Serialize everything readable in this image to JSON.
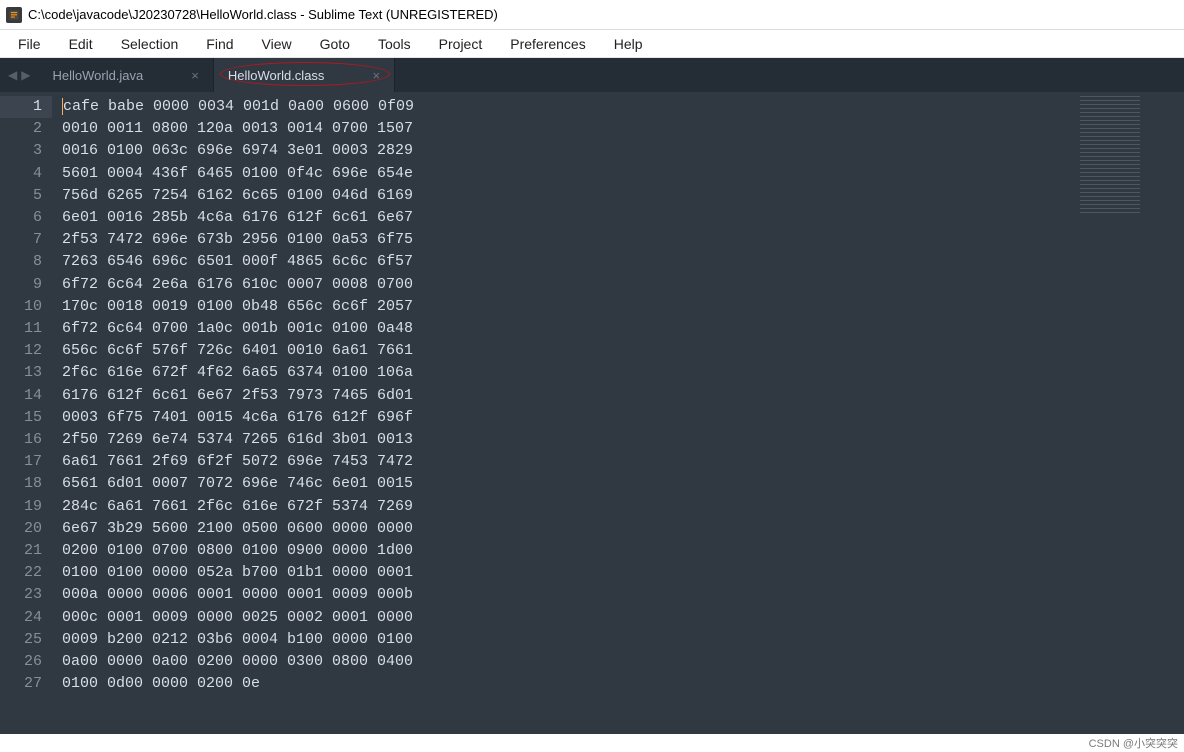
{
  "window": {
    "title": "C:\\code\\javacode\\J20230728\\HelloWorld.class - Sublime Text (UNREGISTERED)"
  },
  "menu": {
    "items": [
      "File",
      "Edit",
      "Selection",
      "Find",
      "View",
      "Goto",
      "Tools",
      "Project",
      "Preferences",
      "Help"
    ]
  },
  "tabs": {
    "items": [
      {
        "label": "HelloWorld.java",
        "active": false
      },
      {
        "label": "HelloWorld.class",
        "active": true
      }
    ]
  },
  "editor": {
    "cursor": {
      "line": 1,
      "col": 1
    },
    "lines": [
      "cafe babe 0000 0034 001d 0a00 0600 0f09",
      "0010 0011 0800 120a 0013 0014 0700 1507",
      "0016 0100 063c 696e 6974 3e01 0003 2829",
      "5601 0004 436f 6465 0100 0f4c 696e 654e",
      "756d 6265 7254 6162 6c65 0100 046d 6169",
      "6e01 0016 285b 4c6a 6176 612f 6c61 6e67",
      "2f53 7472 696e 673b 2956 0100 0a53 6f75",
      "7263 6546 696c 6501 000f 4865 6c6c 6f57",
      "6f72 6c64 2e6a 6176 610c 0007 0008 0700",
      "170c 0018 0019 0100 0b48 656c 6c6f 2057",
      "6f72 6c64 0700 1a0c 001b 001c 0100 0a48",
      "656c 6c6f 576f 726c 6401 0010 6a61 7661",
      "2f6c 616e 672f 4f62 6a65 6374 0100 106a",
      "6176 612f 6c61 6e67 2f53 7973 7465 6d01",
      "0003 6f75 7401 0015 4c6a 6176 612f 696f",
      "2f50 7269 6e74 5374 7265 616d 3b01 0013",
      "6a61 7661 2f69 6f2f 5072 696e 7453 7472",
      "6561 6d01 0007 7072 696e 746c 6e01 0015",
      "284c 6a61 7661 2f6c 616e 672f 5374 7269",
      "6e67 3b29 5600 2100 0500 0600 0000 0000",
      "0200 0100 0700 0800 0100 0900 0000 1d00",
      "0100 0100 0000 052a b700 01b1 0000 0001",
      "000a 0000 0006 0001 0000 0001 0009 000b",
      "000c 0001 0009 0000 0025 0002 0001 0000",
      "0009 b200 0212 03b6 0004 b100 0000 0100",
      "0a00 0000 0a00 0200 0000 0300 0800 0400",
      "0100 0d00 0000 0200 0e"
    ]
  },
  "footer": {
    "watermark": "CSDN @小突突突"
  }
}
